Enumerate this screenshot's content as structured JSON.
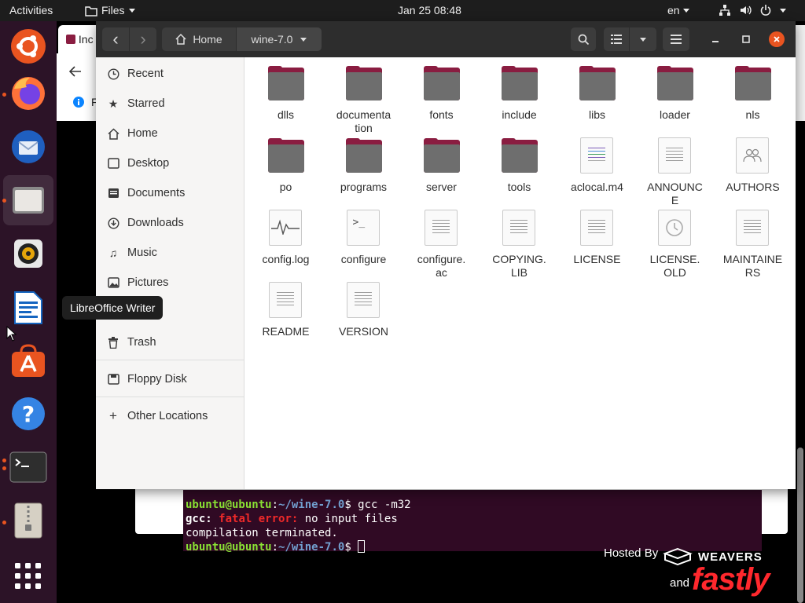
{
  "topbar": {
    "activities": "Activities",
    "app_menu": "Files",
    "clock": "Jan 25  08:48",
    "lang": "en",
    "sys_icons": [
      "network-icon",
      "volume-icon",
      "power-icon"
    ]
  },
  "dock": {
    "items": [
      "ubuntu-software",
      "firefox",
      "thunderbird",
      "files",
      "rhythmbox",
      "libreoffice-writer",
      "app-store",
      "help",
      "terminal",
      "archive",
      "show-applications"
    ]
  },
  "tooltip": "LibreOffice Writer",
  "browser": {
    "tab_label": "Inc",
    "info_label": "F"
  },
  "files": {
    "back": "‹",
    "forward": "›",
    "breadcrumb_home": "Home",
    "breadcrumb_current": "wine-7.0",
    "sidebar": {
      "recent": "Recent",
      "starred": "Starred",
      "home": "Home",
      "desktop": "Desktop",
      "documents": "Documents",
      "downloads": "Downloads",
      "music": "Music",
      "pictures": "Pictures",
      "trash": "Trash",
      "floppy": "Floppy Disk",
      "other": "Other Locations"
    },
    "items": [
      {
        "name": "dlls",
        "type": "folder"
      },
      {
        "name": "documenta\ntion",
        "type": "folder"
      },
      {
        "name": "fonts",
        "type": "folder"
      },
      {
        "name": "include",
        "type": "folder"
      },
      {
        "name": "libs",
        "type": "folder"
      },
      {
        "name": "loader",
        "type": "folder"
      },
      {
        "name": "nls",
        "type": "folder"
      },
      {
        "name": "po",
        "type": "folder"
      },
      {
        "name": "programs",
        "type": "folder"
      },
      {
        "name": "server",
        "type": "folder"
      },
      {
        "name": "tools",
        "type": "folder"
      },
      {
        "name": "aclocal.m4",
        "type": "script"
      },
      {
        "name": "ANNOUNC\nE",
        "type": "text"
      },
      {
        "name": "AUTHORS",
        "type": "people"
      },
      {
        "name": "config.log",
        "type": "log"
      },
      {
        "name": "configure",
        "type": "exec"
      },
      {
        "name": "configure.\nac",
        "type": "text"
      },
      {
        "name": "COPYING.\nLIB",
        "type": "text"
      },
      {
        "name": "LICENSE",
        "type": "text"
      },
      {
        "name": "LICENSE.\nOLD",
        "type": "history"
      },
      {
        "name": "MAINTAINE\nRS",
        "type": "text"
      },
      {
        "name": "README",
        "type": "text"
      },
      {
        "name": "VERSION",
        "type": "text"
      }
    ]
  },
  "terminal": {
    "user": "ubuntu@ubuntu",
    "sep": ":",
    "path": "~/wine-7.0",
    "dollar": "$",
    "cmd1": " gcc -m32",
    "err_prog": "gcc:",
    "err_label": "fatal error:",
    "err_msg": " no input files",
    "line3": "compilation terminated."
  },
  "footer": {
    "hosted_by": "Hosted By",
    "weavers": "WEAVERS",
    "and": "and",
    "fastly": "fastly"
  }
}
